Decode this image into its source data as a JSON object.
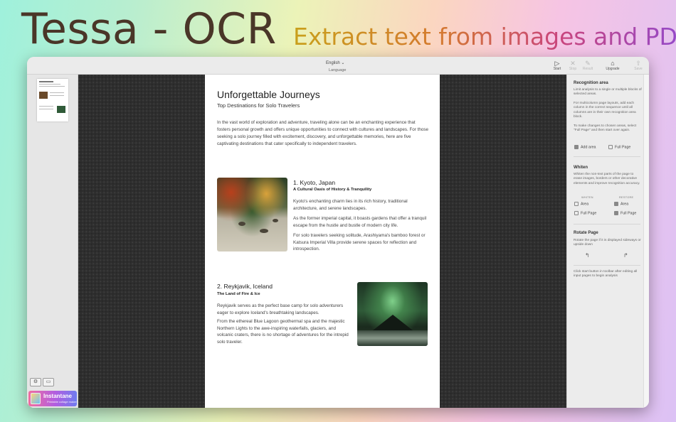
{
  "hero": {
    "title": "Tessa - OCR",
    "subtitle": "Extract text from images and PDFs"
  },
  "toolbar": {
    "language_value": "English",
    "language_label": "Language",
    "buttons": [
      {
        "name": "start",
        "label": "Start",
        "icon": "play-icon",
        "enabled": true
      },
      {
        "name": "stop",
        "label": "Stop",
        "icon": "close-icon",
        "enabled": false
      },
      {
        "name": "result",
        "label": "Result",
        "icon": "edit-icon",
        "enabled": false
      },
      {
        "name": "upgrade",
        "label": "Upgrade",
        "icon": "graduation-cap-icon",
        "enabled": true
      },
      {
        "name": "save",
        "label": "Save",
        "icon": "share-icon",
        "enabled": false
      }
    ]
  },
  "sidebar": {
    "promo_title": "Instantane",
    "promo_subtitle": "Printable collage maker"
  },
  "document": {
    "title": "Unforgettable Journeys",
    "subtitle": "Top Destinations for Solo Travelers",
    "intro": "In the vast world of exploration and adventure, traveling alone can be an enchanting experience that fosters personal growth and offers unique opportunities to connect with cultures and landscapes. For those seeking a solo journey filled with excitement, discovery, and unforgettable memories, here are five captivating destinations that cater specifically to independent travelers.",
    "section1": {
      "title": "1. Kyoto, Japan",
      "tag": "A Cultural Oasis of History & Tranquility",
      "p1": "Kyoto's enchanting charm lies in its rich history, traditional architecture, and serene landscapes.",
      "p2": "As the former imperial capital, it boasts gardens that offer a tranquil escape from the hustle and bustle of modern city life.",
      "p3": "For solo travelers seeking solitude, Arashiyama's bamboo forest or Katsura Imperial Villa provide serene spaces for reflection and introspection."
    },
    "section2": {
      "title": "2. Reykjavik, Iceland",
      "tag": "The Land of Fire & Ice",
      "p1": "Reykjavik serves as the perfect base camp for solo adventurers eager to explore Iceland's breathtaking landscapes.",
      "p2": "From the ethereal Blue Lagoon geothermal spa and the majestic Northern Lights to the awe-inspiring waterfalls, glaciers, and volcanic craters, there is no shortage of adventures for the intrepid solo traveler."
    }
  },
  "inspector": {
    "recognition": {
      "heading": "Recognition area",
      "p1": "Limit analysis to a single or multiple blocks of selected areas.",
      "p2": "For multicolumn page layouts, add each column in the correct sequence until all columns are in their own recognition area block.",
      "p3": "To make changes to chosen areas, select \"Full Page\" and then start over again.",
      "add_area": "Add area",
      "full_page": "Full Page"
    },
    "whiten": {
      "heading": "Whiten",
      "p1": "Whiten the non-text parts of the page to erase images, borders or other decorative elements and improve recognition accuracy.",
      "col_whiten": "WHITEN",
      "col_restore": "RESTORE",
      "area": "Area",
      "full_page": "Full Page"
    },
    "rotate": {
      "heading": "Rotate Page",
      "p1": "Rotate the page if it is displayed sideways or upside down"
    },
    "footer_note": "Click start button in toolbar after editing all input pages to begin analysis"
  }
}
